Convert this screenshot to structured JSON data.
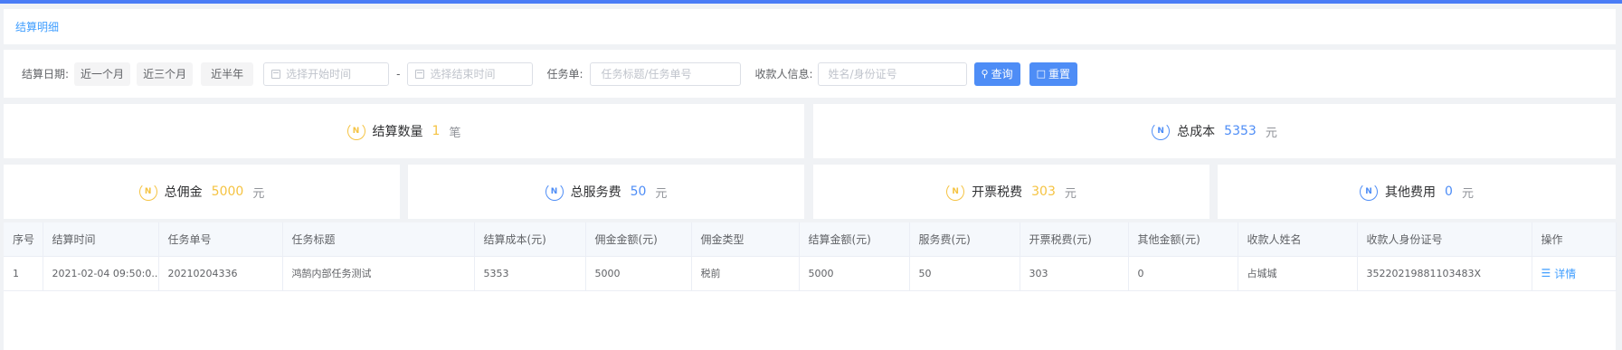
{
  "breadcrumb": "结算明细",
  "filters": {
    "date_label": "结算日期:",
    "quick": [
      "近一个月",
      "近三个月",
      "近半年"
    ],
    "start_placeholder": "选择开始时间",
    "separator": "-",
    "end_placeholder": "选择结束时间",
    "task_label": "任务单:",
    "task_placeholder": "任务标题/任务单号",
    "payee_label": "收款人信息:",
    "payee_placeholder": "姓名/身份证号",
    "query_label": "查询",
    "reset_label": "重置"
  },
  "summary": {
    "count": {
      "label": "结算数量",
      "value": "1",
      "unit": "笔"
    },
    "total_cost": {
      "label": "总成本",
      "value": "5353",
      "unit": "元"
    },
    "commission": {
      "label": "总佣金",
      "value": "5000",
      "unit": "元"
    },
    "service_fee": {
      "label": "总服务费",
      "value": "50",
      "unit": "元"
    },
    "invoice_tax": {
      "label": "开票税费",
      "value": "303",
      "unit": "元"
    },
    "other_fee": {
      "label": "其他费用",
      "value": "0",
      "unit": "元"
    }
  },
  "summary_icon_glyph": "N",
  "colors": {
    "accent": "#4e8df6",
    "gold": "#f5c342",
    "link": "#409eff"
  },
  "table": {
    "columns": [
      "序号",
      "结算时间",
      "任务单号",
      "任务标题",
      "结算成本(元)",
      "佣金金额(元)",
      "佣金类型",
      "结算金额(元)",
      "服务费(元)",
      "开票税费(元)",
      "其他金额(元)",
      "收款人姓名",
      "收款人身份证号",
      "操作"
    ],
    "rows": [
      [
        "1",
        "2021-02-04 09:50:0...",
        "20210204336",
        "鸿鹄内部任务测试",
        "5353",
        "5000",
        "税前",
        "5000",
        "50",
        "303",
        "0",
        "占城城",
        "352202198811034​83X",
        "详情"
      ]
    ]
  }
}
